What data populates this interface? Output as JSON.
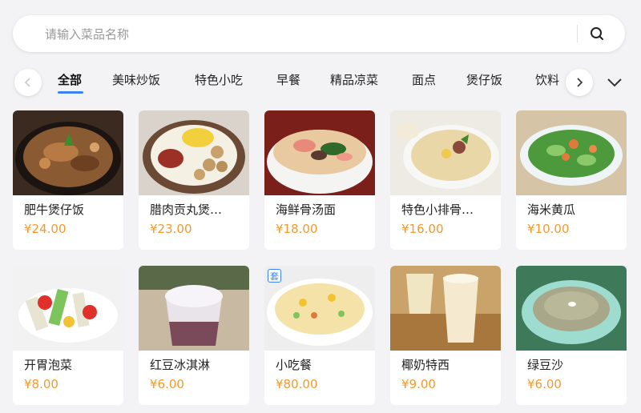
{
  "search": {
    "placeholder": "请输入菜品名称",
    "value": ""
  },
  "categories": {
    "items": [
      "全部",
      "美味炒饭",
      "特色小吃",
      "早餐",
      "精品凉菜",
      "面点",
      "煲仔饭",
      "饮料"
    ],
    "active_index": 0
  },
  "colors": {
    "accent": "#3d83f0",
    "price": "#f29a2e",
    "background": "#f3f3f5"
  },
  "products": [
    {
      "name": "肥牛煲仔饭",
      "price": "¥24.00",
      "badge": ""
    },
    {
      "name": "腊肉贡丸煲…",
      "price": "¥23.00",
      "badge": ""
    },
    {
      "name": "海鲜骨汤面",
      "price": "¥18.00",
      "badge": ""
    },
    {
      "name": "特色小排骨…",
      "price": "¥16.00",
      "badge": ""
    },
    {
      "name": "海米黄瓜",
      "price": "¥10.00",
      "badge": ""
    },
    {
      "name": "开胃泡菜",
      "price": "¥8.00",
      "badge": ""
    },
    {
      "name": "红豆冰淇淋",
      "price": "¥6.00",
      "badge": ""
    },
    {
      "name": "小吃餐",
      "price": "¥80.00",
      "badge": "套"
    },
    {
      "name": "椰奶特西",
      "price": "¥9.00",
      "badge": ""
    },
    {
      "name": "绿豆沙",
      "price": "¥6.00",
      "badge": ""
    }
  ]
}
